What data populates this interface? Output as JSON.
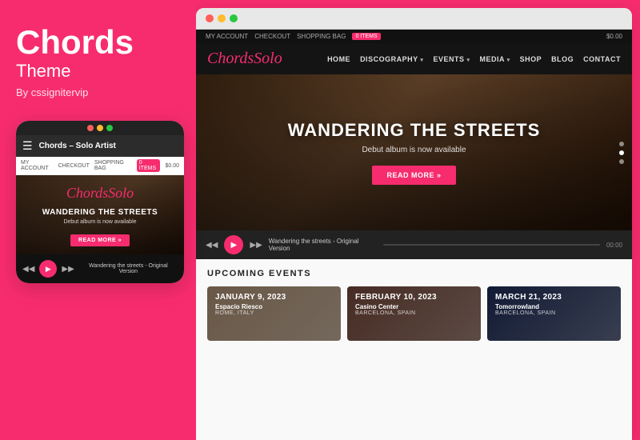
{
  "left": {
    "title": "Chords",
    "subtitle": "Theme",
    "by": "By cssignitervip",
    "mobile": {
      "dots": [
        "#ff5f57",
        "#febc2e",
        "#28c840"
      ],
      "title_bar": "Chords – Solo Artist",
      "account_links": [
        "MY ACCOUNT",
        "CHECKOUT",
        "SHOPPING BAG",
        "0 ITEMS",
        "$0.00"
      ],
      "logo_text": "Chords",
      "logo_highlight": "Solo",
      "hero_title": "WANDERING THE STREETS",
      "hero_sub": "Debut album is now available",
      "read_more": "READ MORE »",
      "track_name": "Wandering the streets - Original Version"
    }
  },
  "browser": {
    "dots": [
      "#ff5f57",
      "#febc2e",
      "#28c840"
    ],
    "topbar": {
      "links": [
        "MY ACCOUNT",
        "CHECKOUT",
        "SHOPPING BAG",
        "0 ITEMS"
      ],
      "price": "$0.00"
    },
    "nav": {
      "logo": "Chords",
      "logo_highlight": "Solo",
      "links": [
        "HOME",
        "DISCOGRAPHY",
        "EVENTS",
        "MEDIA",
        "SHOP",
        "BLOG",
        "CONTACT"
      ]
    },
    "hero": {
      "title": "WANDERING THE STREETS",
      "subtitle": "Debut album is now available",
      "cta": "READ MORE »"
    },
    "player": {
      "track": "Wandering the streets - Original Version",
      "time": "00:00"
    },
    "events": {
      "section_title": "UPCOMING EVENTS",
      "items": [
        {
          "date": "JANUARY 9, 2023",
          "venue": "Espacio Riesco",
          "location": "ROME, ITALY",
          "bg_color": "#c0a080"
        },
        {
          "date": "FEBRUARY 10, 2023",
          "venue": "Casino Center",
          "location": "BARCELONA, SPAIN",
          "bg_color": "#805040"
        },
        {
          "date": "MARCH 21, 2023",
          "venue": "Tomorrowland",
          "location": "BARCELONA, SPAIN",
          "bg_color": "#203060"
        }
      ]
    }
  }
}
